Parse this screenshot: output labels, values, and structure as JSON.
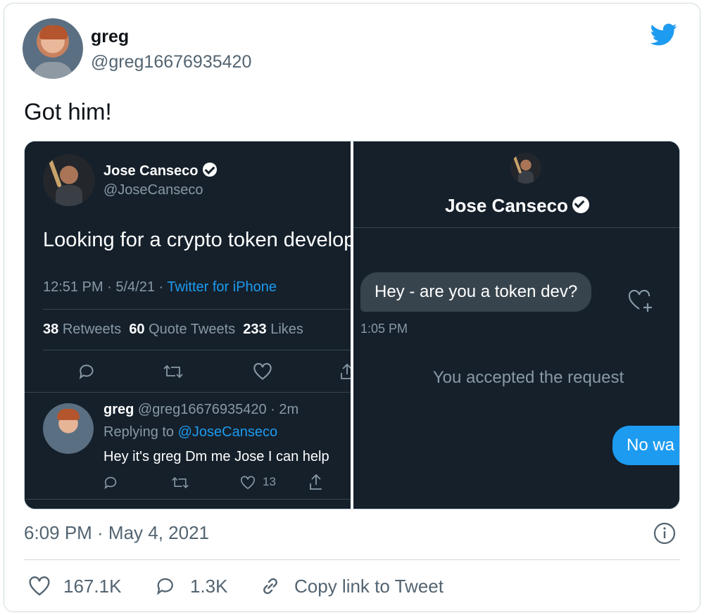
{
  "tweet": {
    "author_name": "greg",
    "author_handle": "@greg16676935420",
    "text": "Got him!",
    "timestamp": "6:09 PM · May 4, 2021",
    "likes": "167.1K",
    "replies": "1.3K",
    "copy_link_label": "Copy link to Tweet"
  },
  "left_panel": {
    "name": "Jose Canseco",
    "handle": "@JoseCanseco",
    "text": "Looking for a crypto token develop",
    "time_date": "12:51 PM · 5/4/21 · ",
    "source": "Twitter for iPhone",
    "retweets_count": "38",
    "retweets_label": "Retweets",
    "quote_count": "60",
    "quote_label": "Quote Tweets",
    "likes_count": "233",
    "likes_label": "Likes",
    "reply": {
      "name": "greg",
      "handle_time": "@greg16676935420 · 2m",
      "replying_to_label": "Replying to ",
      "replying_to_handle": "@JoseCanseco",
      "text": "Hey it's greg Dm me Jose I can help",
      "like_count": "13"
    }
  },
  "right_panel": {
    "name": "Jose Canseco",
    "message_in": "Hey - are you a token dev?",
    "message_time": "1:05 PM",
    "system_text": "You accepted the request",
    "message_out": "No wa"
  },
  "colors": {
    "twitter_blue": "#1d9bf0",
    "dark_bg": "#15202b",
    "gray_text": "#536471"
  }
}
